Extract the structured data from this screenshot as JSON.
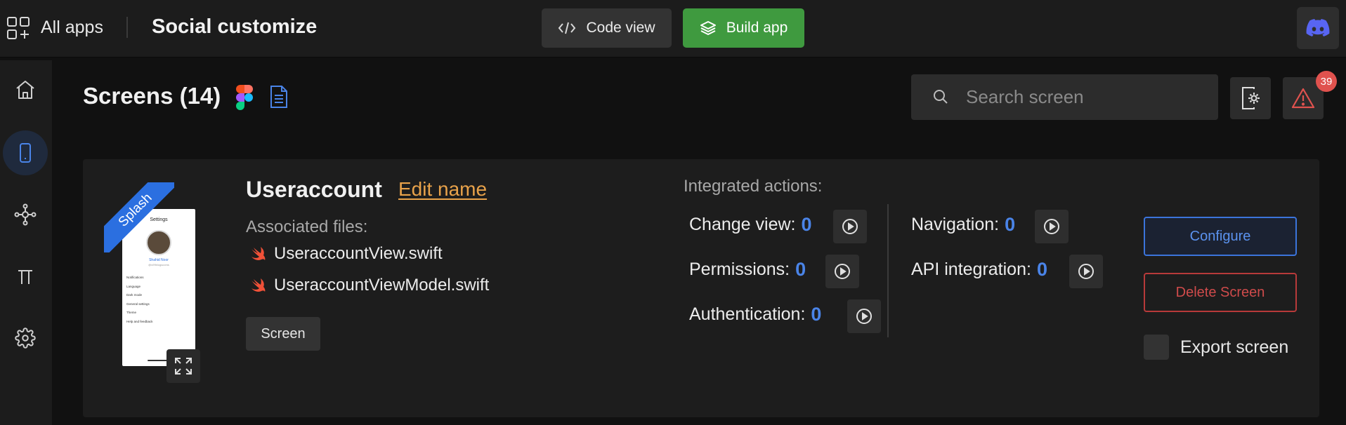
{
  "topbar": {
    "all_apps": "All apps",
    "app_title": "Social customize",
    "code_view": "Code view",
    "build_app": "Build app"
  },
  "sidebar": {
    "items": [
      {
        "icon": "home-icon",
        "active": false
      },
      {
        "icon": "phone-icon",
        "active": true
      },
      {
        "icon": "nodes-icon",
        "active": false
      },
      {
        "icon": "pi-icon",
        "active": false
      },
      {
        "icon": "gear-icon",
        "active": false
      }
    ]
  },
  "header": {
    "title": "Screens (14)",
    "search_placeholder": "Search screen",
    "alert_count": "39"
  },
  "card": {
    "ribbon": "Splash",
    "name": "Useraccount",
    "edit_name": "Edit name",
    "associated_label": "Associated files:",
    "files": [
      "UseraccountView.swift",
      "UseraccountViewModel.swift"
    ],
    "chip": "Screen",
    "integrated_label": "Integrated actions:",
    "actions": {
      "change_view": {
        "label": "Change view:",
        "count": "0"
      },
      "permissions": {
        "label": "Permissions:",
        "count": "0"
      },
      "authentication": {
        "label": "Authentication:",
        "count": "0"
      },
      "navigation": {
        "label": "Navigation:",
        "count": "0"
      },
      "api_integration": {
        "label": "API integration:",
        "count": "0"
      }
    },
    "configure": "Configure",
    "delete": "Delete Screen",
    "export": "Export screen"
  },
  "thumbnail": {
    "title": "Settings",
    "user": "Shahid Noor",
    "handle": "@s99blogscoms",
    "items": [
      "Notifications",
      "Language",
      "Dark mode",
      "General settings",
      "Theme",
      "Help and feedback"
    ]
  },
  "colors": {
    "accent_blue": "#4a84e8",
    "build_green": "#3f9a3f",
    "danger_red": "#cf4b4b",
    "link_orange": "#e8a24a"
  }
}
